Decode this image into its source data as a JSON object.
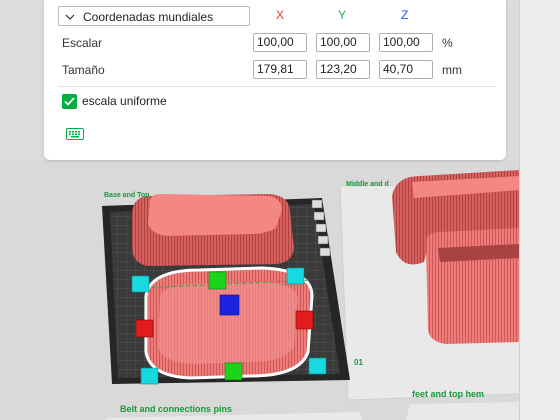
{
  "panel": {
    "coord_system": "Coordenadas mundiales",
    "axes": {
      "x": "X",
      "y": "Y",
      "z": "Z"
    },
    "axis_colors": {
      "x": "#e8352b",
      "y": "#1fae3c",
      "z": "#2a4fe0"
    },
    "scale": {
      "label": "Escalar",
      "x": "100,00",
      "y": "100,00",
      "z": "100,00",
      "unit": "%"
    },
    "size": {
      "label": "Tamaño",
      "x": "179,81",
      "y": "123,20",
      "z": "40,70",
      "unit": "mm"
    },
    "uniform_scale": {
      "label": "escala uniforme",
      "checked": true
    },
    "keyboard_icon": "keyboard-icon"
  },
  "viewport": {
    "plates": {
      "plate1_name": "Base and Top",
      "plate2_name": "Middle and d",
      "plate1_number": "01",
      "plate3_name": "Belt and connections pins",
      "plate4_name": "feet and top hem"
    },
    "colors": {
      "model": "#f07b78",
      "plate": "#3b3b3b",
      "accent": "#00ae42",
      "handle_cyan": "#18d8e0",
      "handle_red": "#e21c1c",
      "handle_green": "#1dd41d",
      "handle_blue": "#1c24e0"
    }
  }
}
